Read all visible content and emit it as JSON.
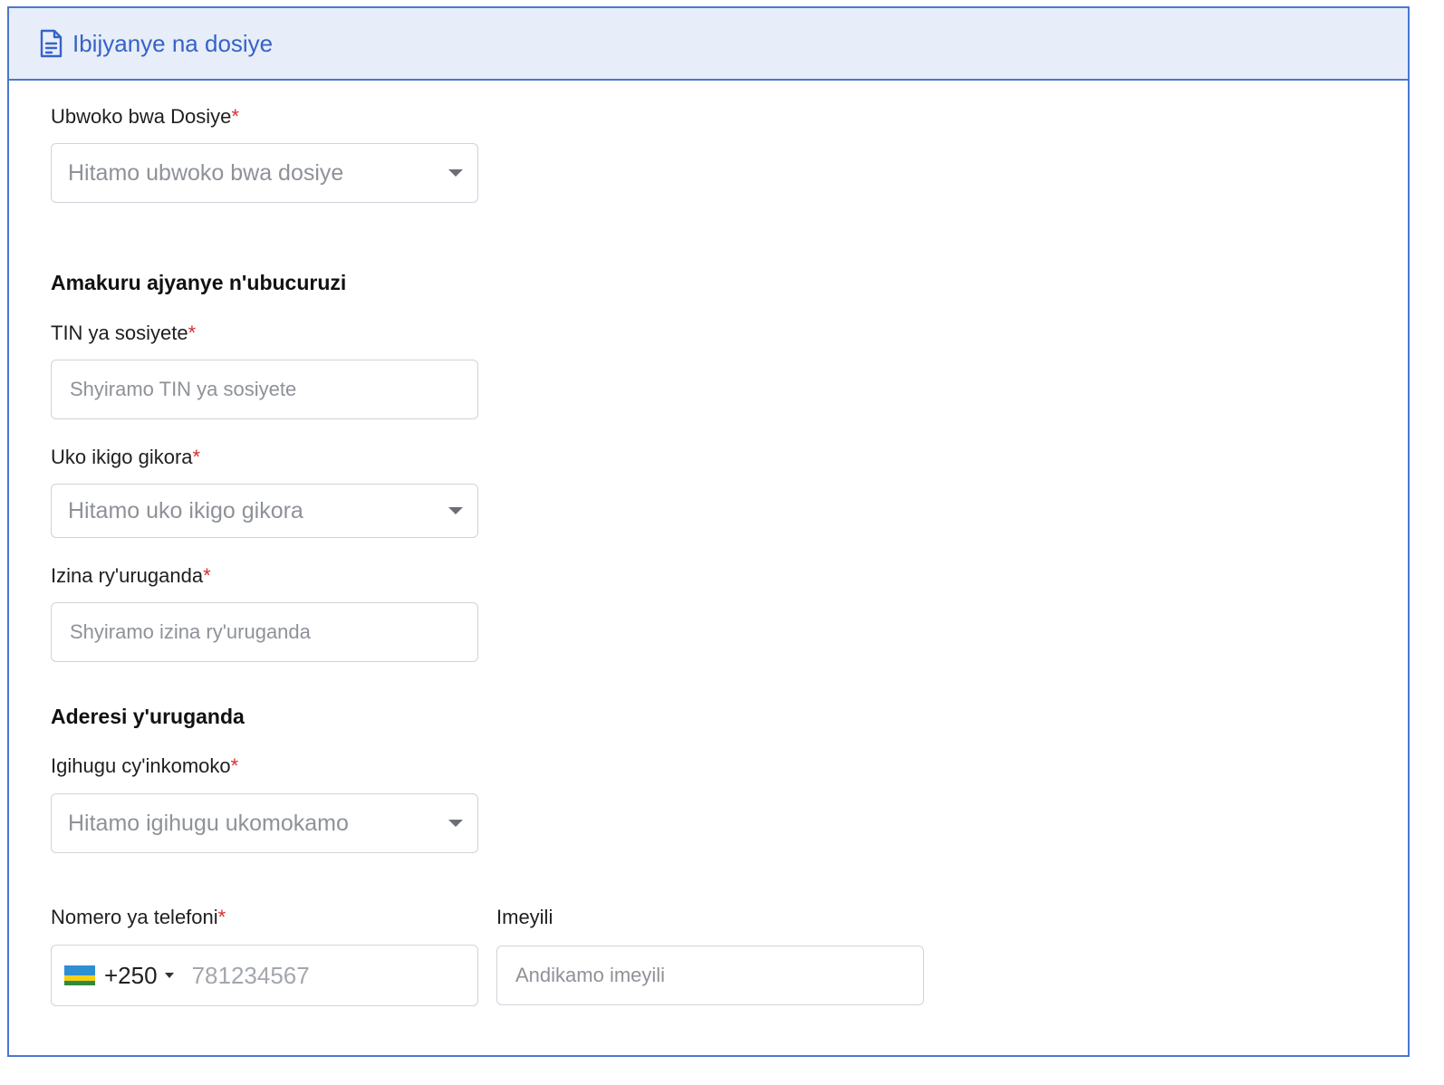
{
  "header": {
    "icon": "document-icon",
    "title": "Ibijyanye na dosiye"
  },
  "form": {
    "file_type": {
      "label": "Ubwoko bwa Dosiye",
      "required_mark": "*",
      "placeholder": "Hitamo ubwoko bwa dosiye"
    },
    "business_section_title": "Amakuru ajyanye n'ubucuruzi",
    "tin": {
      "label": "TIN ya sosiyete",
      "required_mark": "*",
      "placeholder": "Shyiramo TIN ya sosiyete"
    },
    "location": {
      "label": "Uko ikigo gikora",
      "required_mark": "*",
      "placeholder": "Hitamo uko ikigo gikora"
    },
    "factory_name": {
      "label": "Izina ry'uruganda",
      "required_mark": "*",
      "placeholder": "Shyiramo izina ry'uruganda"
    },
    "address_section_title": "Aderesi y'uruganda",
    "country": {
      "label": "Igihugu cy'inkomoko",
      "required_mark": "*",
      "placeholder": "Hitamo igihugu ukomokamo"
    },
    "phone": {
      "label": "Nomero ya telefoni",
      "required_mark": "*",
      "country_code": "+250",
      "flag": "rwanda-flag",
      "placeholder": "781234567"
    },
    "email": {
      "label": "Imeyili",
      "placeholder": "Andikamo imeyili"
    }
  },
  "colors": {
    "accent": "#3563c9",
    "header_bg": "#e8eef9",
    "required": "#d32f2f",
    "border": "#4a78cf"
  }
}
